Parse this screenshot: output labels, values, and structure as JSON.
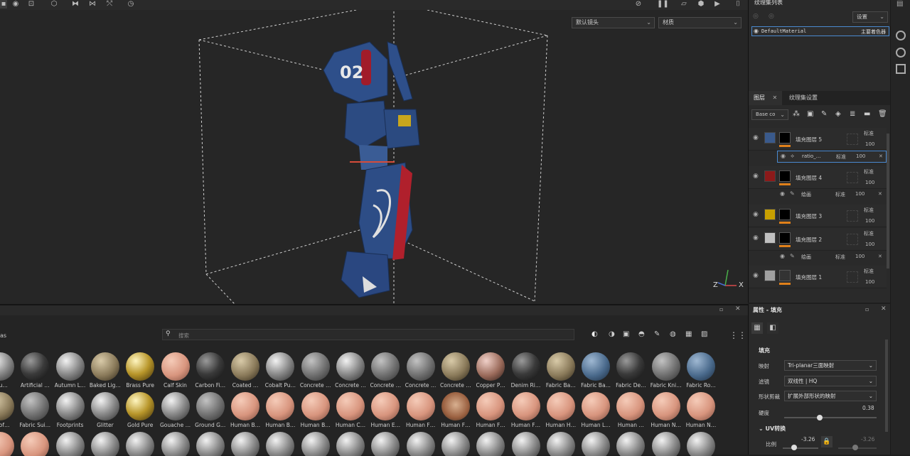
{
  "viewport": {
    "camera_dropdown": "默认镜头",
    "channel_dropdown": "材质",
    "axis_labels": {
      "z": "Z",
      "x": "X"
    }
  },
  "texture_set": {
    "title": "纹理集列表",
    "settings_dropdown": "设置",
    "material_name": "DefaultMaterial",
    "material_shader": "主要着色器"
  },
  "layers_panel": {
    "tabs": [
      "图层",
      "纹理集设置"
    ],
    "channel_select": "Base co",
    "layers": [
      {
        "name": "填充图层 5",
        "blend": "标准",
        "opacity": "100",
        "color": "#3a5a8c",
        "sub": {
          "name": "ratio_…",
          "blend": "标准",
          "opacity": "100"
        }
      },
      {
        "name": "填充图层 4",
        "blend": "标准",
        "opacity": "100",
        "color": "#8c1a1a",
        "sub": {
          "name": "绘画",
          "blend": "标准",
          "opacity": "100"
        }
      },
      {
        "name": "填充图层 3",
        "blend": "标准",
        "opacity": "100",
        "color": "#c8a000"
      },
      {
        "name": "填充图层 2",
        "blend": "标准",
        "opacity": "100",
        "color": "#c0c0c0",
        "sub": {
          "name": "绘画",
          "blend": "标准",
          "opacity": "100"
        }
      },
      {
        "name": "填充图层 1",
        "blend": "标准",
        "opacity": "100",
        "color": "#a0a0a0"
      }
    ]
  },
  "properties": {
    "title": "属性 - 填充",
    "section": "填充",
    "mapping_label": "映射",
    "mapping_value": "Tri-planar三面映射",
    "filter_label": "滤镜",
    "filter_value": "双线性 | HQ",
    "shape_label": "形状剪裁",
    "shape_value": "扩展外部形状的映射",
    "hardness_label": "硬度",
    "hardness_value": "0.38",
    "uv_section": "UV转换",
    "scale_label": "比例",
    "scale_value_1": "-3.26",
    "scale_value_2": "-3.26"
  },
  "shelf": {
    "left_label": "as",
    "search_placeholder": "搜索",
    "row1": [
      "…iu…",
      "Artificial …",
      "Autumn L…",
      "Baked Lig…",
      "Brass Pure",
      "Calf Skin",
      "Carbon Fi…",
      "Coated …",
      "Cobalt Pu…",
      "Concrete …",
      "Concrete …",
      "Concrete …",
      "Concrete …",
      "Concrete …",
      "Copper P…",
      "Denim Ri…",
      "Fabric Ba…",
      "Fabric Ba…",
      "Fabric De…",
      "Fabric Kni…",
      "Fabric Ro…"
    ],
    "row2": [
      "…Sof…",
      "Fabric Sui…",
      "Footprints",
      "Glitter",
      "Gold Pure",
      "Gouache …",
      "Ground G…",
      "Human B…",
      "Human B…",
      "Human B…",
      "Human C…",
      "Human E…",
      "Human F…",
      "Human F…",
      "Human F…",
      "Human F…",
      "Human H…",
      "Human L…",
      "Human …",
      "Human N…",
      "Human N…"
    ]
  }
}
